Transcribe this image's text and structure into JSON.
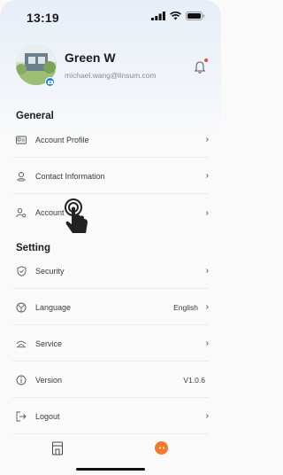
{
  "status_bar": {
    "time": "13:19"
  },
  "profile": {
    "name": "Green W",
    "email": "michael.wang@linsum.com"
  },
  "general": {
    "title": "General",
    "items": [
      {
        "label": "Account Profile",
        "icon": "id-card-icon"
      },
      {
        "label": "Contact Information",
        "icon": "contact-icon"
      },
      {
        "label": "Account",
        "icon": "user-gear-icon"
      }
    ]
  },
  "setting": {
    "title": "Setting",
    "items": [
      {
        "label": "Security",
        "icon": "shield-icon",
        "value": ""
      },
      {
        "label": "Language",
        "icon": "globe-icon",
        "value": "English"
      },
      {
        "label": "Service",
        "icon": "service-icon",
        "value": ""
      },
      {
        "label": "Version",
        "icon": "info-icon",
        "value": "V1.0.6"
      },
      {
        "label": "Logout",
        "icon": "logout-icon",
        "value": ""
      }
    ]
  },
  "colors": {
    "accent": "#1d7fe8",
    "tab_active": "#f47a2b",
    "notification": "#e74c3c"
  }
}
